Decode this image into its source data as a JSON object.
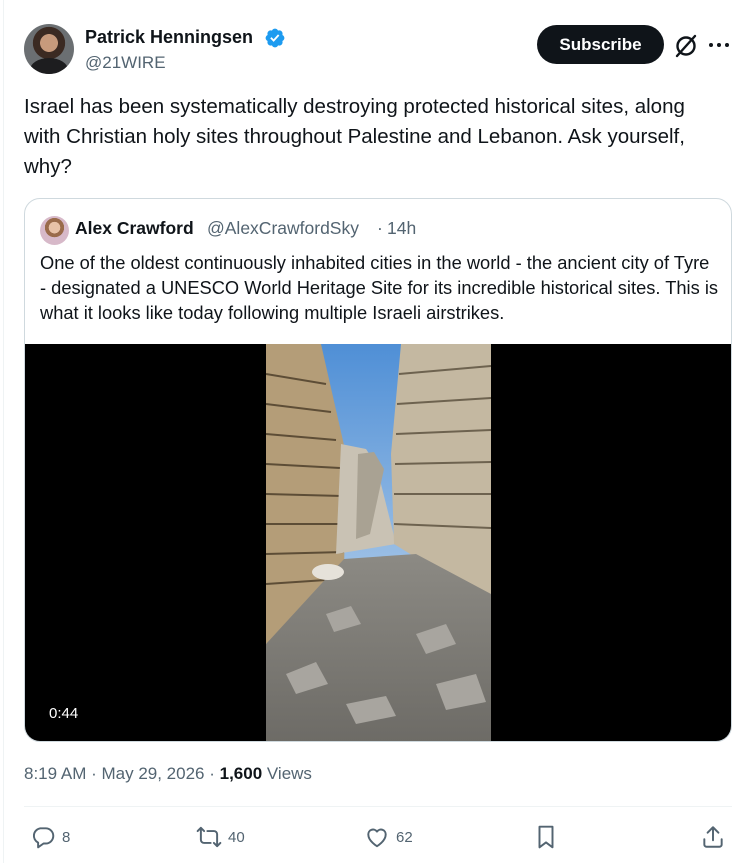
{
  "author": {
    "name": "Patrick Henningsen",
    "handle": "@21WIRE",
    "verified": true
  },
  "header": {
    "subscribe_label": "Subscribe",
    "grok_icon": "grok-icon",
    "more_icon": "more-icon"
  },
  "tweet": {
    "text": "Israel has been systematically destroying protected historical sites, along with Christian holy sites throughout Palestine and Lebanon. Ask yourself, why?"
  },
  "quote": {
    "name": "Alex Crawford",
    "handle": "@AlexCrawfordSky",
    "dot": "·",
    "time": "14h",
    "text": "One of the oldest continuously inhabited cities in the world - the ancient city of Tyre - designated a UNESCO World Heritage Site for its incredible historical sites. This is what it looks like today following multiple Israeli airstrikes.",
    "video_duration": "0:44"
  },
  "meta": {
    "time": "8:19 AM",
    "sep1": " · ",
    "date": "May 29, 2026",
    "sep2": " · ",
    "views_count": "1,600",
    "views_label": " Views"
  },
  "actions": {
    "replies": "8",
    "reposts": "40",
    "likes": "62"
  },
  "colors": {
    "verified_blue": "#1d9bf0",
    "text_primary": "#0f1419",
    "text_secondary": "#536471",
    "border": "#cfd9de"
  }
}
